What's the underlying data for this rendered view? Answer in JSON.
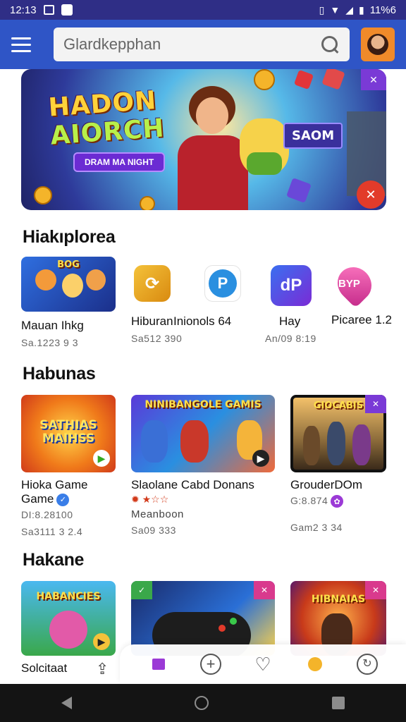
{
  "status_bar": {
    "time": "12:13",
    "battery_text": "11%6"
  },
  "search": {
    "value": "Glardkepphan"
  },
  "banner": {
    "title_line1": "HADON",
    "title_line2": "AIORCH",
    "cta_label": "DRAM MA NIGHT",
    "tag_label": "SAOM"
  },
  "sections": [
    {
      "title": "Hiakıplorea",
      "items": [
        {
          "name": "Mauan Ihkg",
          "meta": "Sa.1223 9 3",
          "thumb_text": "BOG"
        },
        {
          "name": "Hiburan",
          "meta": "Sa512 390"
        },
        {
          "name": "Inionols 64",
          "meta": ""
        },
        {
          "name": "Hay",
          "meta": "An/09 8:19"
        },
        {
          "name": "Picaree 1.2",
          "meta": "",
          "icon_text": "BYP"
        }
      ]
    },
    {
      "title": "Habunas",
      "items": [
        {
          "name": "Hioka Game",
          "name2": "Game",
          "meta1": "DI:8.28100",
          "meta2": "Sa3111 3 2.4",
          "thumb_text": "SATHIAS MAIHSS"
        },
        {
          "name": "Slaolane Cabd Donans",
          "sub": "Meanboon",
          "meta2": "Sa09 333",
          "thumb_text": "NINIBANGOLE GAMIS"
        },
        {
          "name": "GrouderDOm",
          "meta1": "G:8.874",
          "meta2": "Gam2 3 34",
          "thumb_text": "GIOCABIS"
        }
      ]
    },
    {
      "title": "Hakane",
      "items": [
        {
          "name": "Solcitaat",
          "meta": "",
          "thumb_text": "HABANCIES"
        },
        {
          "name": "",
          "meta": ""
        },
        {
          "name": "",
          "meta": "",
          "thumb_text": "HIBNAIAS"
        }
      ]
    }
  ],
  "colors": {
    "status_bar": "#2f2e86",
    "app_bar": "#2f55c6",
    "nav_bar": "#141414"
  }
}
